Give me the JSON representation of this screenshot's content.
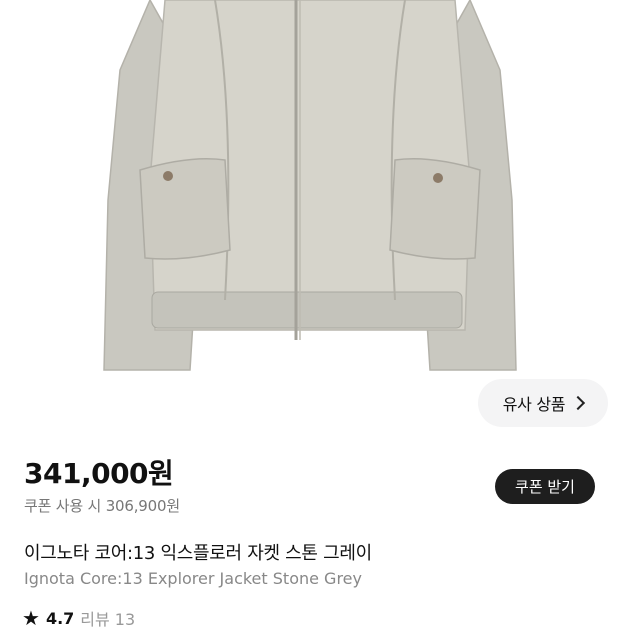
{
  "product": {
    "similar_label": "유사 상품",
    "price": "341,000원",
    "coupon_price_text": "쿠폰 사용 시 306,900원",
    "coupon_button_label": "쿠폰 받기",
    "title_ko": "이그노타 코어:13 익스플로러 자켓 스톤 그레이",
    "title_en": "Ignota Core:13 Explorer Jacket Stone Grey",
    "rating": "4.7",
    "review_text": "리뷰 13"
  },
  "icons": {
    "similar_chevron": "chevron-right-icon",
    "rating_star": "star-icon"
  },
  "colors": {
    "coupon_button_bg": "#1e1e1e",
    "similar_button_bg": "#f4f4f5",
    "jacket": "#cfcdc4"
  }
}
